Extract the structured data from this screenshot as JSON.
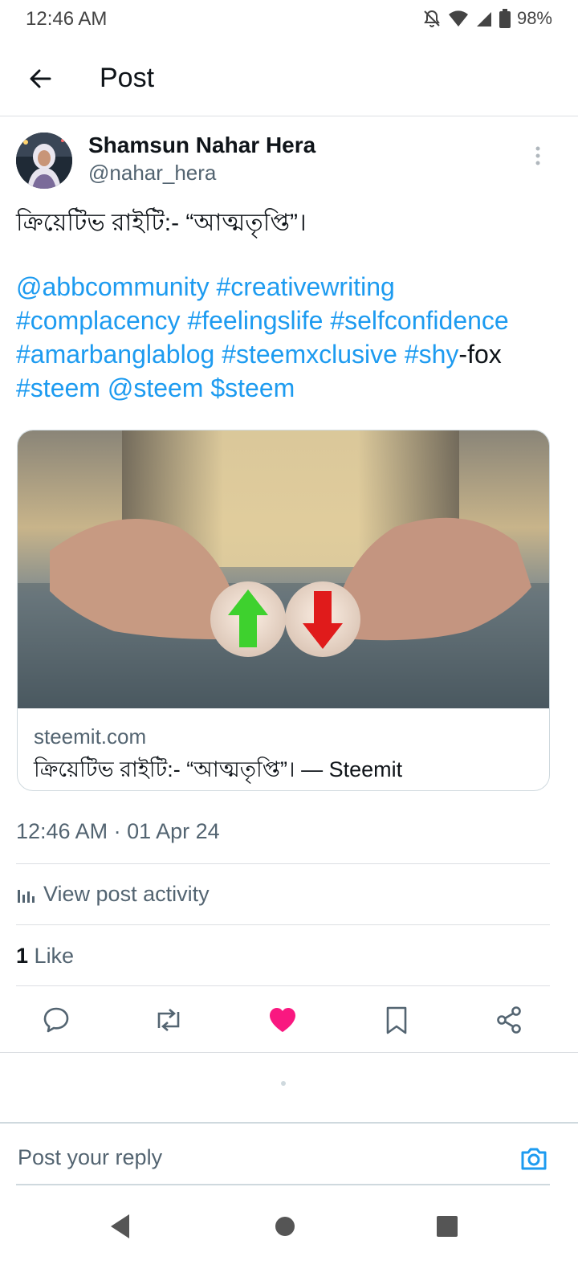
{
  "status_bar": {
    "time": "12:46 AM",
    "battery": "98%",
    "icons": [
      "bell-off-icon",
      "wifi-icon",
      "signal-icon",
      "battery-icon"
    ]
  },
  "header": {
    "title": "Post",
    "back_icon": "arrow-left-icon"
  },
  "author": {
    "name": "Shamsun Nahar Hera",
    "handle": "@nahar_hera"
  },
  "post": {
    "title": "ক্রিয়েটিভ রাইটি:- “আত্মতৃপ্তি”।",
    "tags": {
      "t1": "@abbcommunity",
      "t2": "#creativewriting",
      "t3": "#complacency",
      "t4": "#feelingslife",
      "t5": "#selfconfidence",
      "t6": "#amarbanglablog",
      "t7": "#steemxclusive",
      "t8": "#shy",
      "t8_suffix": "-fox",
      "t9": "#steem",
      "t10": "@steem",
      "t11": "$steem"
    },
    "card": {
      "domain": "steemit.com",
      "title": "ক্রিয়েটিভ রাইটি:- “আত্মতৃপ্তি”। — Steemit"
    },
    "timestamp": "12:46 AM · 01 Apr 24",
    "activity_label": "View post activity",
    "likes_count": "1",
    "likes_label": "Like"
  },
  "actions": [
    "reply-icon",
    "repost-icon",
    "like-icon",
    "bookmark-icon",
    "share-icon"
  ],
  "colors": {
    "accent": "#1d9bf0",
    "like": "#f91880",
    "text": "#0f1419",
    "muted": "#536471"
  },
  "reply": {
    "placeholder": "Post your reply"
  }
}
